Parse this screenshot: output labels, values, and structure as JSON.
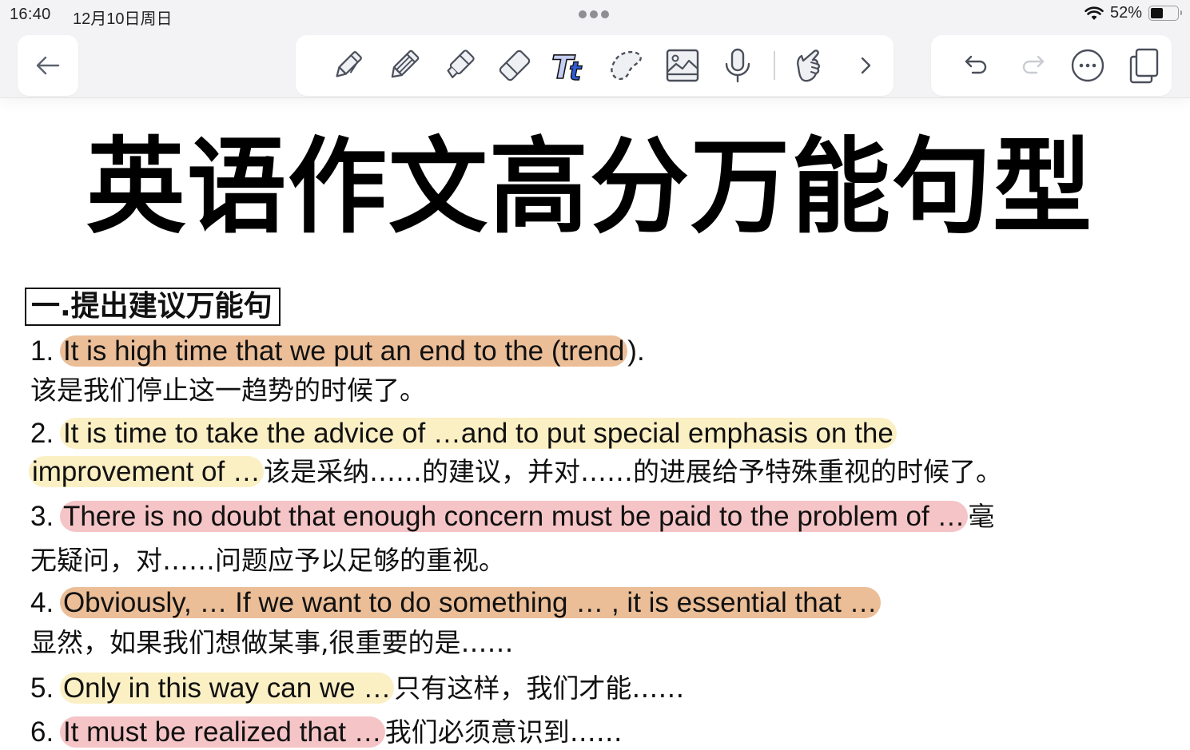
{
  "status_bar": {
    "time": "16:40",
    "date": "12月10日周日",
    "battery_percent": "52%",
    "battery_level": 0.52
  },
  "toolbar": {
    "back_icon": "arrow-left-icon",
    "tools": [
      {
        "name": "pen",
        "icon": "fountain-pen-icon"
      },
      {
        "name": "pencil",
        "icon": "pencil-icon"
      },
      {
        "name": "highlighter",
        "icon": "highlighter-icon"
      },
      {
        "name": "eraser",
        "icon": "eraser-icon"
      },
      {
        "name": "text",
        "icon": "text-tool-icon",
        "label": "Tt",
        "selected": true
      },
      {
        "name": "lasso",
        "icon": "lasso-icon"
      },
      {
        "name": "image",
        "icon": "image-icon"
      },
      {
        "name": "microphone",
        "icon": "microphone-icon"
      },
      {
        "name": "hand",
        "icon": "pointing-hand-icon"
      },
      {
        "name": "more-tools",
        "icon": "chevron-right-icon"
      }
    ],
    "actions": [
      {
        "name": "undo",
        "icon": "undo-icon"
      },
      {
        "name": "redo",
        "icon": "redo-icon",
        "disabled": true
      },
      {
        "name": "more",
        "icon": "more-circle-icon"
      },
      {
        "name": "pages",
        "icon": "copy-pages-icon"
      }
    ]
  },
  "colors": {
    "highlight_orange": "#ebbe98",
    "highlight_yellow": "#fbefc4",
    "highlight_pink": "#f5c4c6"
  },
  "document": {
    "title": "英语作文高分万能句型",
    "section_heading": "一.提出建议万能句",
    "items": [
      {
        "number": "1.",
        "english": "It is high time that we put an end to the (trend",
        "english_tail": ").",
        "chinese": "该是我们停止这一趋势的时候了。"
      },
      {
        "number": "2.",
        "english_line1": "It is time to take the advice of …and to put special emphasis on the",
        "english_line2": "improvement of …",
        "chinese": "该是采纳……的建议，并对……的进展给予特殊重视的时候了。"
      },
      {
        "number": "3.",
        "english": "There is no doubt that enough concern must be paid to the problem of …",
        "chinese_line1": "毫",
        "chinese_line2": "无疑问，对……问题应予以足够的重视。"
      },
      {
        "number": "4.",
        "english": "Obviously, … If we want to do something … , it is essential that …",
        "chinese": "显然，如果我们想做某事,很重要的是……"
      },
      {
        "number": "5.",
        "english": "Only in this way can we …",
        "chinese": "只有这样，我们才能……"
      },
      {
        "number": "6.",
        "english": "It must be realized that …",
        "chinese": "我们必须意识到……"
      }
    ]
  }
}
